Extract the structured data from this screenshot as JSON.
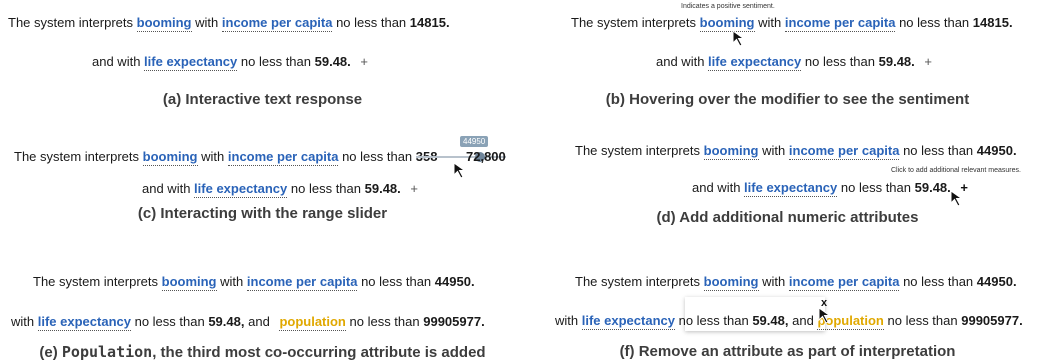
{
  "common": {
    "prefix": "The system interprets",
    "modifier": "booming",
    "with": "with",
    "attr_income": "income per capita",
    "no_less_than": "no less than",
    "and_with": "and with",
    "attr_life": "life expectancy",
    "life_value": "59.48.",
    "plus": "+"
  },
  "panel_a": {
    "income_value": "14815.",
    "caption": "(a) Interactive text response"
  },
  "panel_b": {
    "tooltip": "Indicates a positive sentiment.",
    "income_value": "14815.",
    "caption": "(b) Hovering over the modifier to see the sentiment"
  },
  "panel_c": {
    "slider_min": "358",
    "slider_badge": "44950",
    "slider_max": "72,800",
    "caption": "(c) Interacting with the range slider"
  },
  "panel_d": {
    "income_value": "44950.",
    "tooltip": "Click to add additional relevant measures.",
    "caption": "(d) Add additional numeric attributes"
  },
  "panel_e": {
    "income_value": "44950.",
    "life_value_comma": "59.48,",
    "and": "and",
    "attr_population": "population",
    "population_value": "99905977.",
    "caption_mono": "Population",
    "caption_rest": ", the third most co-occurring attribute is added",
    "caption_prefix": "(e)"
  },
  "panel_f": {
    "income_value": "44950.",
    "remove_label": "x",
    "caption": "(f) Remove an attribute as part of interpretation"
  }
}
